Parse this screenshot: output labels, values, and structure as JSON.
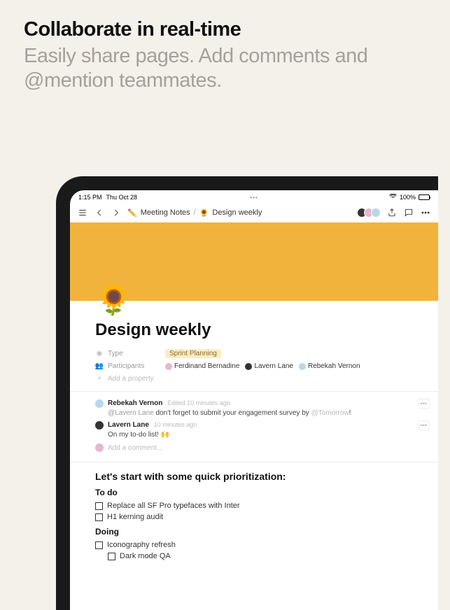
{
  "promo": {
    "title": "Collaborate in real-time",
    "subtitle": "Easily share pages. Add comments and @mention teammates."
  },
  "status_bar": {
    "time": "1:15 PM",
    "date": "Thu Oct 28",
    "center": "•••",
    "battery": "100%"
  },
  "breadcrumb": {
    "first_emoji": "✏️",
    "first_label": "Meeting Notes",
    "sep": "/",
    "second_emoji": "🌻",
    "second_label": "Design weekly"
  },
  "page": {
    "icon": "🌻",
    "title": "Design weekly",
    "props": {
      "type_label": "Type",
      "type_value": "Sprint Planning",
      "participants_label": "Participants",
      "participants": [
        "Ferdinand Bernadine",
        "Lavern Lane",
        "Rebekah Vernon"
      ],
      "add_property": "Add a property"
    }
  },
  "comments": [
    {
      "author": "Rebekah Vernon",
      "meta": "Edited 10 minutes ago",
      "mention": "@Lavern Lane",
      "text": " don't forget to submit your engagement survey by ",
      "date_mention": "@Tomorrow",
      "suffix": "!"
    },
    {
      "author": "Lavern Lane",
      "meta": "10 minutes ago",
      "text": "On my to-do list! 🙌"
    }
  ],
  "add_comment_placeholder": "Add a comment...",
  "content": {
    "heading": "Let's start with some quick prioritization:",
    "todo_label": "To do",
    "todo_items": [
      "Replace all SF Pro typefaces with Inter",
      "H1 kerning audit"
    ],
    "doing_label": "Doing",
    "doing_items": [
      "Iconography refresh",
      "Dark mode QA"
    ]
  }
}
